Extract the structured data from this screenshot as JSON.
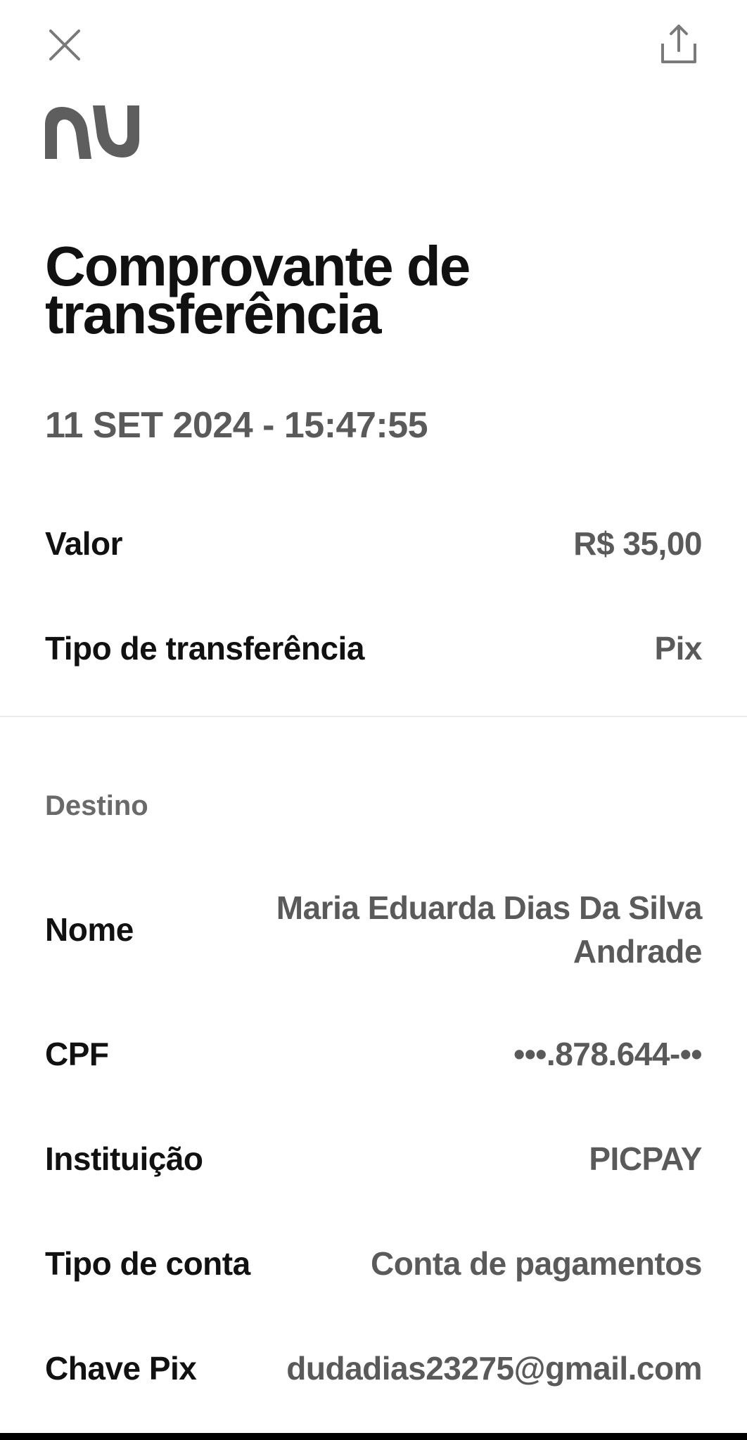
{
  "header": {
    "close_icon": "close-icon",
    "share_icon": "share-icon",
    "logo_icon": "nu-logo"
  },
  "receipt": {
    "title_line1": "Comprovante de",
    "title_line2": "transferência",
    "datetime": "11 SET 2024 - 15:47:55",
    "summary": {
      "valor_label": "Valor",
      "valor_value": "R$ 35,00",
      "tipo_label": "Tipo de transferência",
      "tipo_value": "Pix"
    },
    "destino": {
      "section_title": "Destino",
      "nome_label": "Nome",
      "nome_value": "Maria Eduarda Dias Da Silva Andrade",
      "cpf_label": "CPF",
      "cpf_value": "•••.878.644-••",
      "instituicao_label": "Instituição",
      "instituicao_value": "PICPAY",
      "tipo_conta_label": "Tipo de conta",
      "tipo_conta_value": "Conta de pagamentos",
      "chave_label": "Chave Pix",
      "chave_value": "dudadias23275@gmail.com"
    }
  },
  "colors": {
    "primary_text": "#111111",
    "secondary_text": "#5a5a5a",
    "logo": "#5e5e5e",
    "divider": "#ececec"
  }
}
